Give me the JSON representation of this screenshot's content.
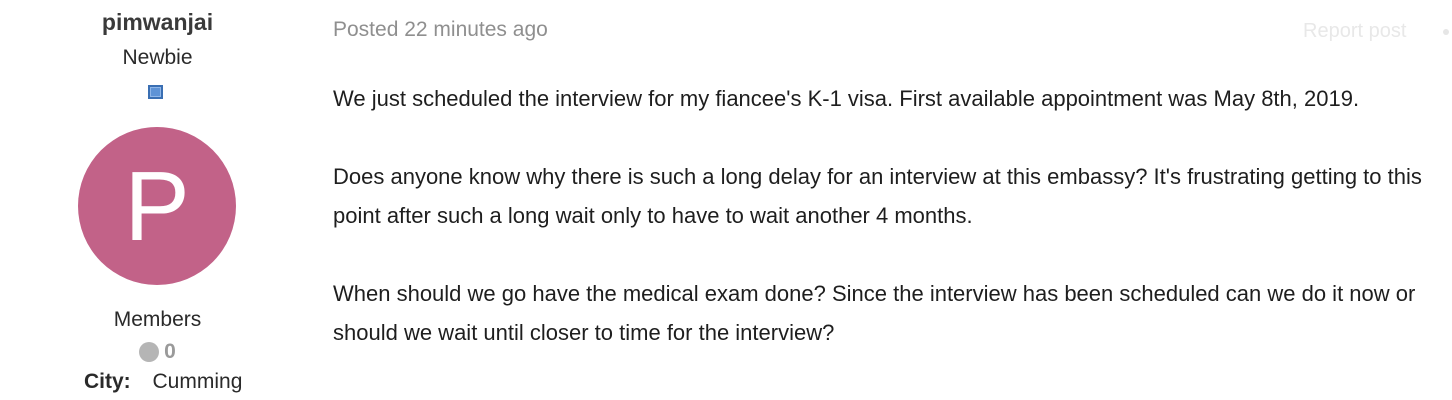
{
  "author": {
    "name": "pimwanjai",
    "title": "Newbie",
    "avatar_letter": "P",
    "avatar_color": "#c26288",
    "group": "Members",
    "reputation": "0",
    "city_label": "City:",
    "city_value": "Cumming"
  },
  "post": {
    "posted_text": "Posted 22 minutes ago",
    "report_label": "Report post",
    "paragraphs": [
      "We just scheduled the interview for my fiancee's K-1 visa. First available appointment was May 8th, 2019.",
      "Does anyone know why there is such a long delay for an interview at this embassy? It's frustrating getting to this point after such a long wait only to have to wait another 4 months.",
      "When should we go have the medical exam done? Since the interview has been scheduled can we do it now or should we wait until closer to time for the interview?"
    ]
  }
}
